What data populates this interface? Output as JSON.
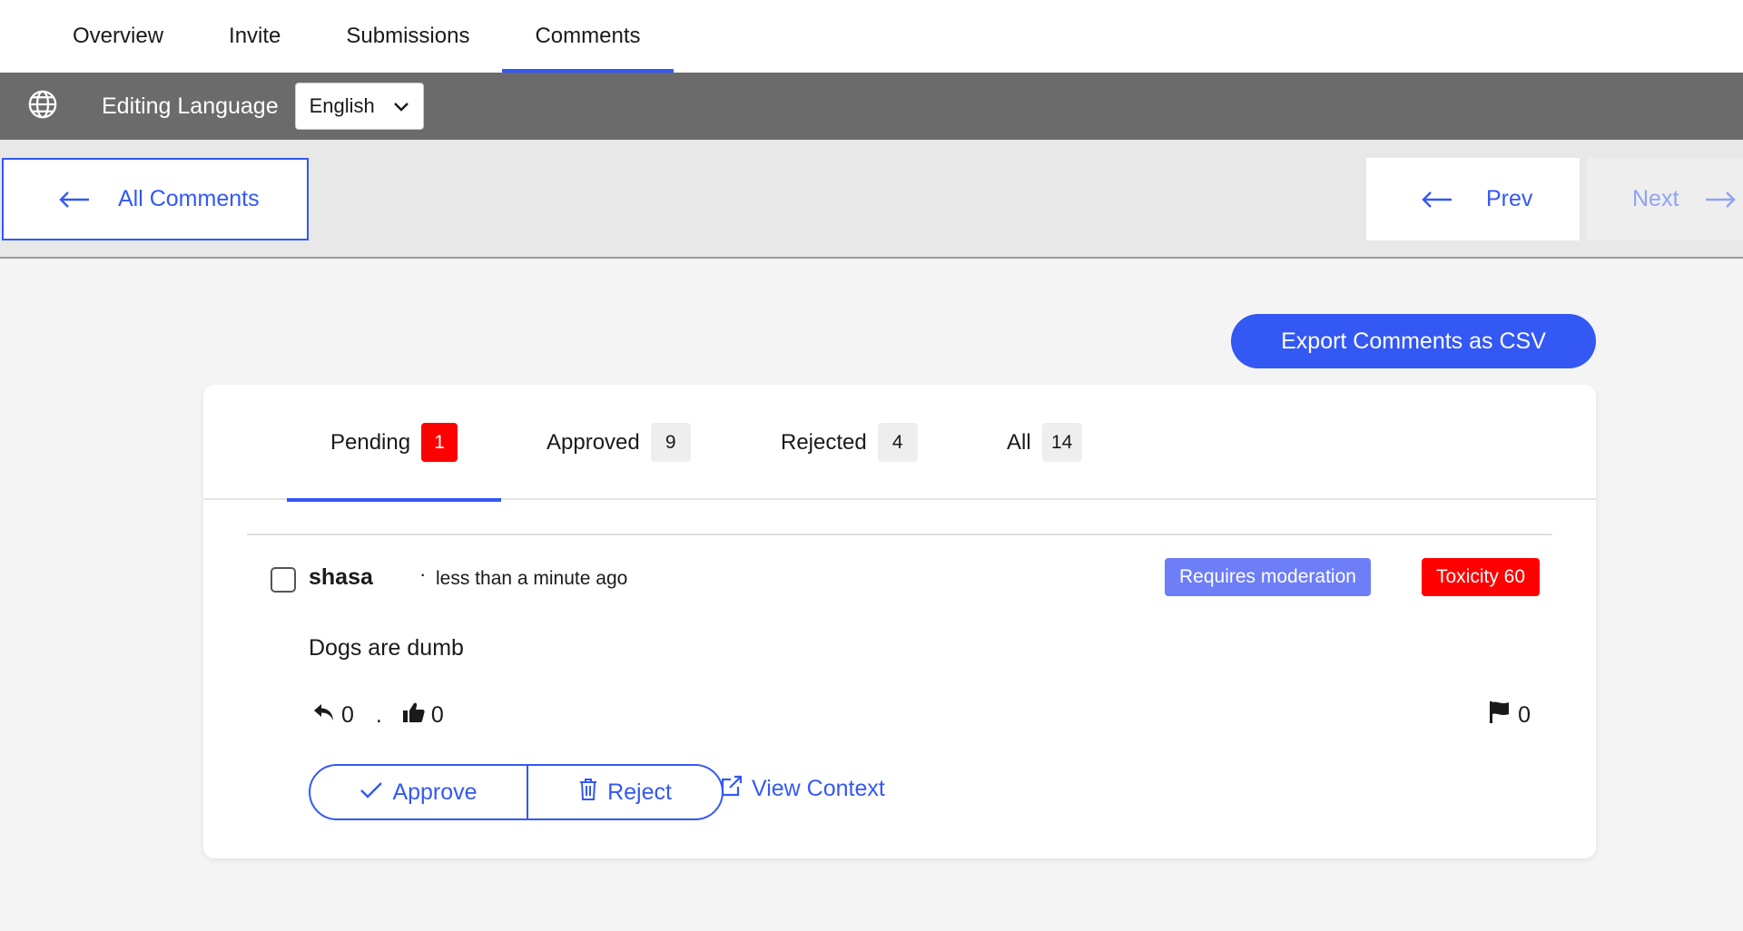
{
  "top_tabs": [
    {
      "label": "Overview"
    },
    {
      "label": "Invite"
    },
    {
      "label": "Submissions"
    },
    {
      "label": "Comments",
      "active": true
    }
  ],
  "language_bar": {
    "icon": "globe-icon",
    "label": "Editing Language",
    "selected": "English"
  },
  "nav": {
    "all_comments": "All Comments",
    "prev": "Prev",
    "next": "Next"
  },
  "export_label": "Export Comments as CSV",
  "status_tabs": [
    {
      "label": "Pending",
      "count": "1",
      "active": true
    },
    {
      "label": "Approved",
      "count": "9"
    },
    {
      "label": "Rejected",
      "count": "4"
    },
    {
      "label": "All",
      "count": "14"
    }
  ],
  "comment": {
    "author": "shasa",
    "separator": "·",
    "time": "less than a minute ago",
    "badges": {
      "moderation": "Requires moderation",
      "toxicity": "Toxicity 60"
    },
    "body": "Dogs are dumb",
    "replies": "0",
    "stat_separator": ".",
    "likes": "0",
    "flags": "0",
    "approve": "Approve",
    "reject": "Reject",
    "view_context": "View Context"
  },
  "colors": {
    "accent": "#3358f4",
    "danger": "#ff0000",
    "moderation": "#6d7ef7",
    "lang_bar": "#6b6b6b"
  }
}
